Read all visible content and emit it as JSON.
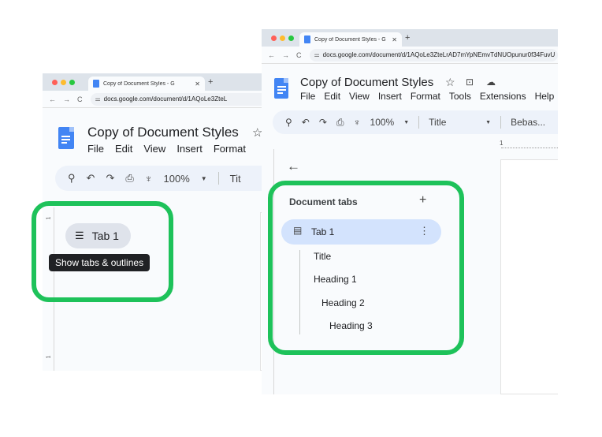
{
  "left_window": {
    "tab_title": "Copy of Document Styles - G",
    "url": "docs.google.com/document/d/1AQoLe3ZteL",
    "doc_title": "Copy of Document Styles",
    "menus": [
      "File",
      "Edit",
      "View",
      "Insert",
      "Format"
    ],
    "zoom": "100%",
    "style_select": "Tit",
    "tab_pill": "Tab 1",
    "tooltip": "Show tabs & outlines",
    "ruler_number": "1"
  },
  "right_window": {
    "tab_title": "Copy of Document Styles - G",
    "url": "docs.google.com/document/d/1AQoLe3ZteLrAD7mYpNEmvTdNUOpunur0f34FuvU",
    "doc_title": "Copy of Document Styles",
    "menus": [
      "File",
      "Edit",
      "View",
      "Insert",
      "Format",
      "Tools",
      "Extensions",
      "Help"
    ],
    "zoom": "100%",
    "style_select": "Title",
    "font_select": "Bebas...",
    "ruler_number": "1",
    "panel": {
      "heading": "Document tabs",
      "tab_label": "Tab 1",
      "outline": [
        "Title",
        "Heading 1",
        "Heading 2",
        "Heading 3"
      ]
    }
  },
  "colors": {
    "highlight_border": "#1ec25a",
    "docs_blue": "#4285f4",
    "selected_tab_bg": "#d3e3fd"
  }
}
